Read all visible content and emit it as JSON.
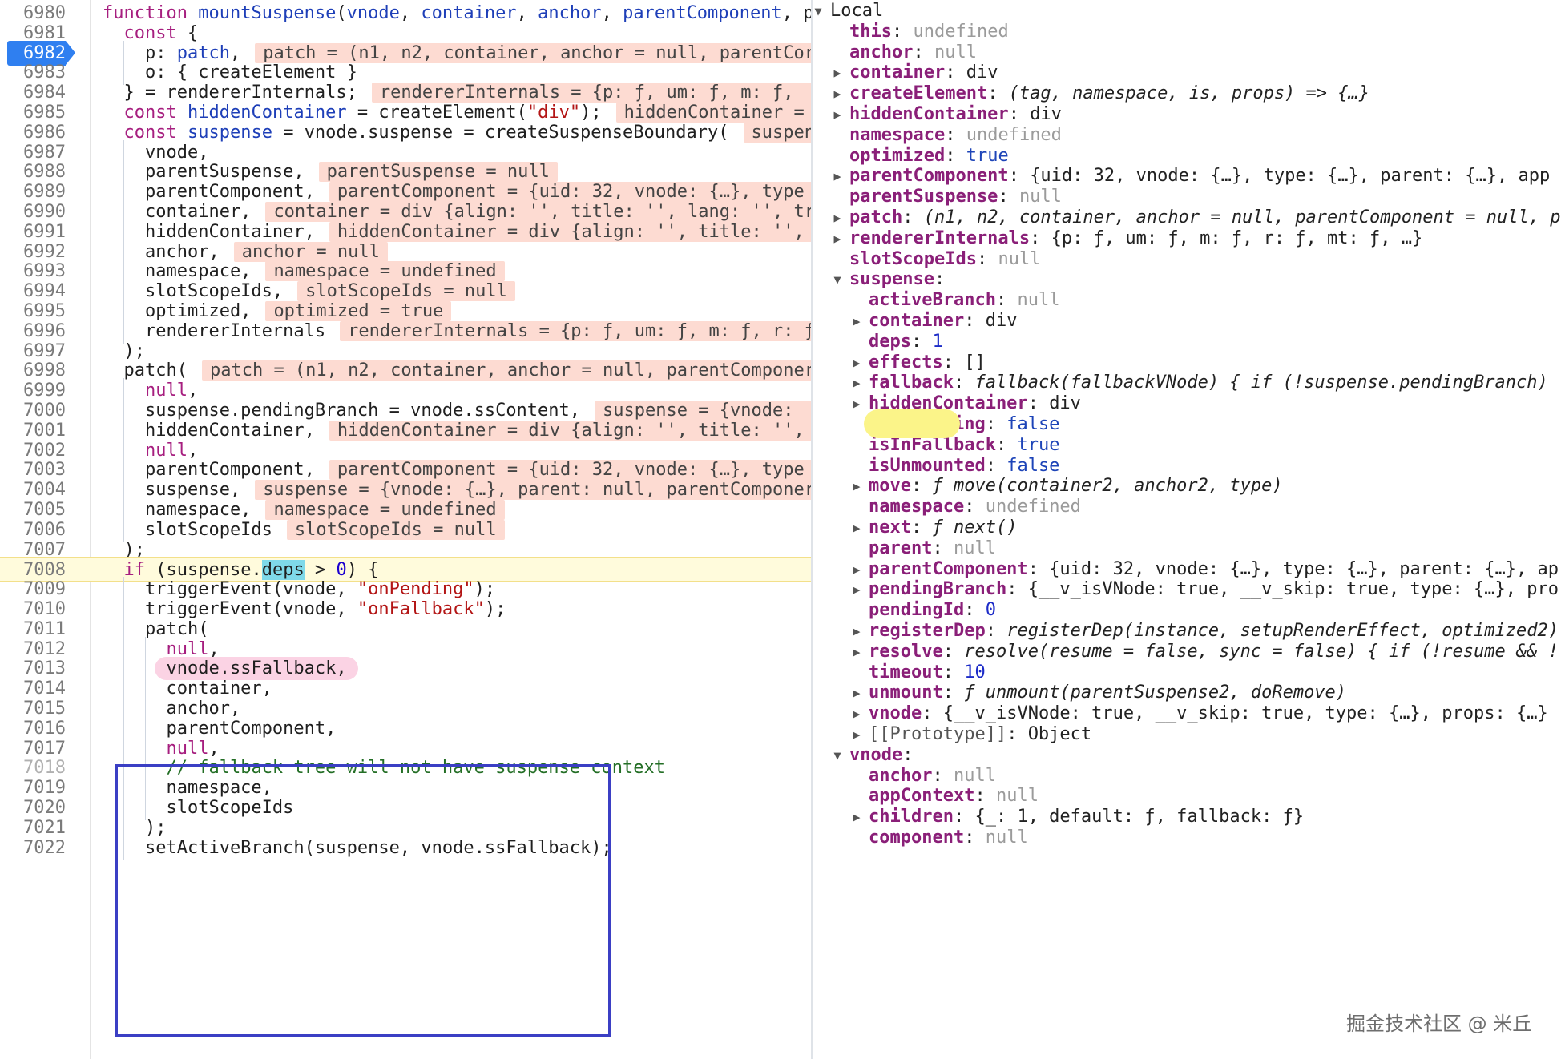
{
  "code": {
    "active_line": "6982",
    "lines": [
      {
        "n": "6980",
        "text": "function mountSuspense(vnode, container, anchor, parentComponent, p"
      },
      {
        "n": "6981",
        "text": "  const {"
      },
      {
        "n": "6982",
        "text": "    p: patch,",
        "eval": "patch = (n1, n2, container, anchor = null, parentCor"
      },
      {
        "n": "6983",
        "text": "    o: { createElement }"
      },
      {
        "n": "6984",
        "text": "  } = rendererInternals;",
        "eval": "rendererInternals = {p: ƒ, um: ƒ, m: ƒ, "
      },
      {
        "n": "6985",
        "text": "  const hiddenContainer = createElement(\"div\");",
        "eval": "hiddenContainer = "
      },
      {
        "n": "6986",
        "text": "  const suspense = vnode.suspense = createSuspenseBoundary(",
        "eval": "suspen"
      },
      {
        "n": "6987",
        "text": "    vnode,"
      },
      {
        "n": "6988",
        "text": "    parentSuspense,",
        "eval": "parentSuspense = null"
      },
      {
        "n": "6989",
        "text": "    parentComponent,",
        "eval": "parentComponent = {uid: 32, vnode: {…}, type"
      },
      {
        "n": "6990",
        "text": "    container,",
        "eval": "container = div {align: '', title: '', lang: '', tr"
      },
      {
        "n": "6991",
        "text": "    hiddenContainer,",
        "eval": "hiddenContainer = div {align: '', title: '', "
      },
      {
        "n": "6992",
        "text": "    anchor,",
        "eval": "anchor = null"
      },
      {
        "n": "6993",
        "text": "    namespace,",
        "eval": "namespace = undefined"
      },
      {
        "n": "6994",
        "text": "    slotScopeIds,",
        "eval": "slotScopeIds = null"
      },
      {
        "n": "6995",
        "text": "    optimized,",
        "eval": "optimized = true"
      },
      {
        "n": "6996",
        "text": "    rendererInternals",
        "eval": "rendererInternals = {p: ƒ, um: ƒ, m: ƒ, r: ƒ"
      },
      {
        "n": "6997",
        "text": "  );"
      },
      {
        "n": "6998",
        "text": "  patch(",
        "eval": "patch = (n1, n2, container, anchor = null, parentComponer"
      },
      {
        "n": "6999",
        "text": "    null,"
      },
      {
        "n": "7000",
        "text": "    suspense.pendingBranch = vnode.ssContent,",
        "eval": "suspense = {vnode: "
      },
      {
        "n": "7001",
        "text": "    hiddenContainer,",
        "eval": "hiddenContainer = div {align: '', title: '', "
      },
      {
        "n": "7002",
        "text": "    null,"
      },
      {
        "n": "7003",
        "text": "    parentComponent,",
        "eval": "parentComponent = {uid: 32, vnode: {…}, type"
      },
      {
        "n": "7004",
        "text": "    suspense,",
        "eval": "suspense = {vnode: {…}, parent: null, parentComponer"
      },
      {
        "n": "7005",
        "text": "    namespace,",
        "eval": "namespace = undefined"
      },
      {
        "n": "7006",
        "text": "    slotScopeIds",
        "eval": "slotScopeIds = null"
      },
      {
        "n": "7007",
        "text": "  );"
      },
      {
        "n": "7008",
        "text": "  if (suspense.deps > 0) {"
      },
      {
        "n": "7009",
        "text": "    triggerEvent(vnode, \"onPending\");"
      },
      {
        "n": "7010",
        "text": "    triggerEvent(vnode, \"onFallback\");"
      },
      {
        "n": "7011",
        "text": "    patch("
      },
      {
        "n": "7012",
        "text": "      null,"
      },
      {
        "n": "7013",
        "text": "      vnode.ssFallback,"
      },
      {
        "n": "7014",
        "text": "      container,"
      },
      {
        "n": "7015",
        "text": "      anchor,"
      },
      {
        "n": "7016",
        "text": "      parentComponent,"
      },
      {
        "n": "7017",
        "text": "      null,"
      },
      {
        "n": "7018",
        "text": "      // fallback tree will not have suspense context"
      },
      {
        "n": "7019",
        "text": "      namespace,"
      },
      {
        "n": "7020",
        "text": "      slotScopeIds"
      },
      {
        "n": "7021",
        "text": "    );"
      },
      {
        "n": "7022",
        "text": "    setActiveBranch(suspense, vnode.ssFallback);"
      }
    ]
  },
  "scope": {
    "rows": [
      {
        "depth": 0,
        "expander": "open",
        "key": "Local",
        "value": "",
        "vtype": "header"
      },
      {
        "depth": 1,
        "expander": "none",
        "key": "this",
        "value": "undefined",
        "vtype": "null"
      },
      {
        "depth": 1,
        "expander": "none",
        "key": "anchor",
        "value": "null",
        "vtype": "null"
      },
      {
        "depth": 1,
        "expander": "closed",
        "key": "container",
        "value": "div",
        "vtype": "str"
      },
      {
        "depth": 1,
        "expander": "closed",
        "key": "createElement",
        "value": "(tag, namespace, is, props) => {…}",
        "vtype": "fn"
      },
      {
        "depth": 1,
        "expander": "closed",
        "key": "hiddenContainer",
        "value": "div",
        "vtype": "str"
      },
      {
        "depth": 1,
        "expander": "none",
        "key": "namespace",
        "value": "undefined",
        "vtype": "null"
      },
      {
        "depth": 1,
        "expander": "none",
        "key": "optimized",
        "value": "true",
        "vtype": "bool"
      },
      {
        "depth": 1,
        "expander": "closed",
        "key": "parentComponent",
        "value": "{uid: 32, vnode: {…}, type: {…}, parent: {…}, app",
        "vtype": "obj"
      },
      {
        "depth": 1,
        "expander": "none",
        "key": "parentSuspense",
        "value": "null",
        "vtype": "null"
      },
      {
        "depth": 1,
        "expander": "closed",
        "key": "patch",
        "value": "(n1, n2, container, anchor = null, parentComponent = null, p",
        "vtype": "fn"
      },
      {
        "depth": 1,
        "expander": "closed",
        "key": "rendererInternals",
        "value": "{p: ƒ, um: ƒ, m: ƒ, r: ƒ, mt: ƒ, …}",
        "vtype": "obj"
      },
      {
        "depth": 1,
        "expander": "none",
        "key": "slotScopeIds",
        "value": "null",
        "vtype": "null"
      },
      {
        "depth": 1,
        "expander": "open",
        "key": "suspense",
        "value": "",
        "vtype": "str"
      },
      {
        "depth": 2,
        "expander": "none",
        "key": "activeBranch",
        "value": "null",
        "vtype": "null"
      },
      {
        "depth": 2,
        "expander": "closed",
        "key": "container",
        "value": "div",
        "vtype": "str"
      },
      {
        "depth": 2,
        "expander": "none",
        "key": "deps",
        "value": "1",
        "vtype": "num"
      },
      {
        "depth": 2,
        "expander": "closed",
        "key": "effects",
        "value": "[]",
        "vtype": "str"
      },
      {
        "depth": 2,
        "expander": "closed",
        "key": "fallback",
        "value": "fallback(fallbackVNode) { if (!suspense.pendingBranch)",
        "vtype": "fn"
      },
      {
        "depth": 2,
        "expander": "closed",
        "key": "hiddenContainer",
        "value": "div",
        "vtype": "str"
      },
      {
        "depth": 2,
        "expander": "none",
        "key": "isHydrating",
        "value": "false",
        "vtype": "bool"
      },
      {
        "depth": 2,
        "expander": "none",
        "key": "isInFallback",
        "value": "true",
        "vtype": "bool"
      },
      {
        "depth": 2,
        "expander": "none",
        "key": "isUnmounted",
        "value": "false",
        "vtype": "bool"
      },
      {
        "depth": 2,
        "expander": "closed",
        "key": "move",
        "value": "ƒ move(container2, anchor2, type)",
        "vtype": "fn"
      },
      {
        "depth": 2,
        "expander": "none",
        "key": "namespace",
        "value": "undefined",
        "vtype": "null"
      },
      {
        "depth": 2,
        "expander": "closed",
        "key": "next",
        "value": "ƒ next()",
        "vtype": "fn"
      },
      {
        "depth": 2,
        "expander": "none",
        "key": "parent",
        "value": "null",
        "vtype": "null"
      },
      {
        "depth": 2,
        "expander": "closed",
        "key": "parentComponent",
        "value": "{uid: 32, vnode: {…}, type: {…}, parent: {…}, ap",
        "vtype": "obj"
      },
      {
        "depth": 2,
        "expander": "closed",
        "key": "pendingBranch",
        "value": "{__v_isVNode: true, __v_skip: true, type: {…}, pro",
        "vtype": "obj"
      },
      {
        "depth": 2,
        "expander": "none",
        "key": "pendingId",
        "value": "0",
        "vtype": "num"
      },
      {
        "depth": 2,
        "expander": "closed",
        "key": "registerDep",
        "value": "registerDep(instance, setupRenderEffect, optimized2)",
        "vtype": "fn"
      },
      {
        "depth": 2,
        "expander": "closed",
        "key": "resolve",
        "value": "resolve(resume = false, sync = false) { if (!resume && !",
        "vtype": "fn"
      },
      {
        "depth": 2,
        "expander": "none",
        "key": "timeout",
        "value": "10",
        "vtype": "num"
      },
      {
        "depth": 2,
        "expander": "closed",
        "key": "unmount",
        "value": "ƒ unmount(parentSuspense2, doRemove)",
        "vtype": "fn"
      },
      {
        "depth": 2,
        "expander": "closed",
        "key": "vnode",
        "value": "{__v_isVNode: true, __v_skip: true, type: {…}, props: {…}",
        "vtype": "obj"
      },
      {
        "depth": 2,
        "expander": "closed",
        "key": "[[Prototype]]",
        "value": "Object",
        "vtype": "proto"
      },
      {
        "depth": 1,
        "expander": "open",
        "key": "vnode",
        "value": "",
        "vtype": "str"
      },
      {
        "depth": 2,
        "expander": "none",
        "key": "anchor",
        "value": "null",
        "vtype": "null"
      },
      {
        "depth": 2,
        "expander": "none",
        "key": "appContext",
        "value": "null",
        "vtype": "null"
      },
      {
        "depth": 2,
        "expander": "closed",
        "key": "children",
        "value": "{_: 1, default: ƒ, fallback: ƒ}",
        "vtype": "obj"
      },
      {
        "depth": 2,
        "expander": "none",
        "key": "component",
        "value": "null",
        "vtype": "null"
      }
    ]
  },
  "watermark": "掘金技术社区 @ 米丘",
  "colors": {
    "breakpoint": "#2f7ff0",
    "eval_bg": "#fddbd2",
    "current_line_bg": "#fffbdc",
    "annotation_box": "#3b3fc4",
    "annotation_pill": "#fbd3e4",
    "deps_highlight": "#fbf489"
  }
}
